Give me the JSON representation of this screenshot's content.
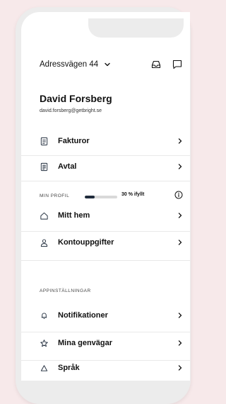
{
  "header": {
    "address": "Adressvägen 44"
  },
  "user": {
    "name": "David Forsberg",
    "email": "david.forsberg@getbright.se"
  },
  "menu_top": [
    {
      "label": "Fakturor",
      "icon": "invoice-icon"
    },
    {
      "label": "Avtal",
      "icon": "contract-icon"
    }
  ],
  "profile": {
    "title": "MIN PROFIL",
    "progress_label": "30 % ifyllt",
    "progress_value": 0.3,
    "items": [
      {
        "label": "Mitt hem",
        "icon": "home-icon"
      },
      {
        "label": "Kontouppgifter",
        "icon": "user-icon"
      }
    ]
  },
  "app_settings": {
    "title": "APPINSTÄLLNINGAR",
    "items": [
      {
        "label": "Notifikationer",
        "icon": "bell-icon"
      },
      {
        "label": "Mina genvägar",
        "icon": "star-icon"
      },
      {
        "label": "Språk",
        "icon": "language-icon"
      }
    ]
  },
  "colors": {
    "background": "#f7e9ea",
    "accent": "#1f2b3b"
  }
}
